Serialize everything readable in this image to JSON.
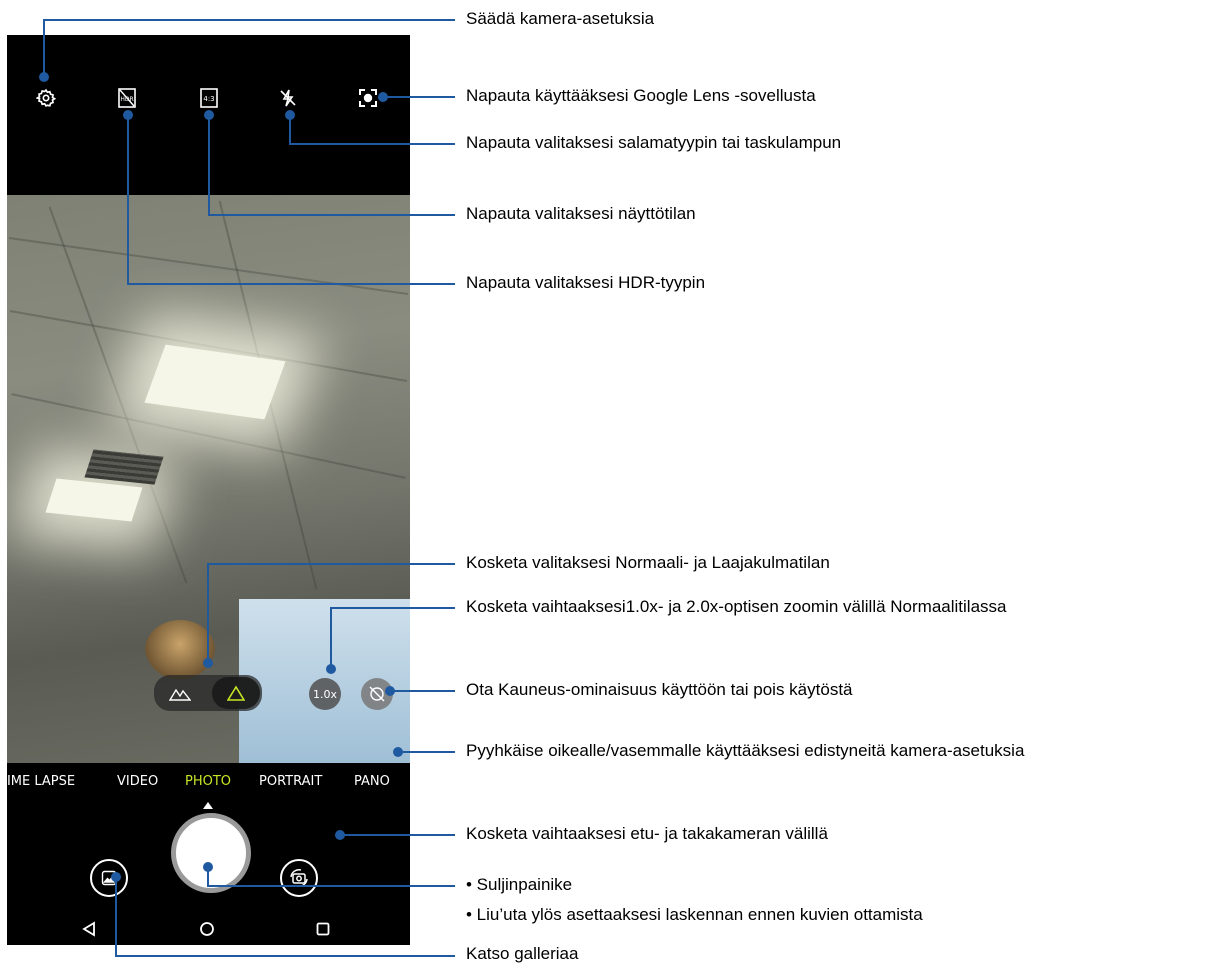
{
  "modes": [
    "TIME LAPSE",
    "VIDEO",
    "PHOTO",
    "PORTRAIT",
    "PANO"
  ],
  "active_mode_color": "#c8e627",
  "zoom_label": "1.0x",
  "annotations": {
    "settings": "Säädä kamera-asetuksia",
    "lens": "Napauta käyttääksesi Google Lens -sovellusta",
    "flash": "Napauta valitaksesi salamatyypin tai taskulampun",
    "aspect": "Napauta valitaksesi näyttötilan",
    "hdr": "Napauta valitaksesi HDR-tyypin",
    "wide": "Kosketa valitaksesi Normaali- ja Laajakulmatilan",
    "zoom": "Kosketa vaihtaaksesi1.0x- ja 2.0x-optisen zoomin välillä Normaalitilassa",
    "beauty": "Ota Kauneus-ominaisuus käyttöön tai pois käytöstä",
    "swipe": "Pyyhkäise oikealle/vasemmalle käyttääksesi edistyneitä kamera-asetuksia",
    "switch": "Kosketa vaihtaaksesi etu- ja takakameran välillä",
    "shutter": "• Suljinpainike",
    "timer": "• Liu’uta ylös asettaaksesi laskennan ennen kuvien ottamista",
    "gallery": "Katso galleriaa"
  },
  "icons": {
    "settings": "gear-icon",
    "hdr": "hdr-off-icon",
    "aspect": "aspect-4-3-icon",
    "flash": "flash-off-icon",
    "lens": "google-lens-icon",
    "wide": "wide-angle-icon",
    "normal": "normal-angle-icon",
    "beauty": "beauty-off-icon",
    "gallery": "gallery-icon",
    "switch": "switch-camera-icon"
  },
  "aspect_icon_text": "4:3",
  "annotation_line_color": "#1f5aa0"
}
